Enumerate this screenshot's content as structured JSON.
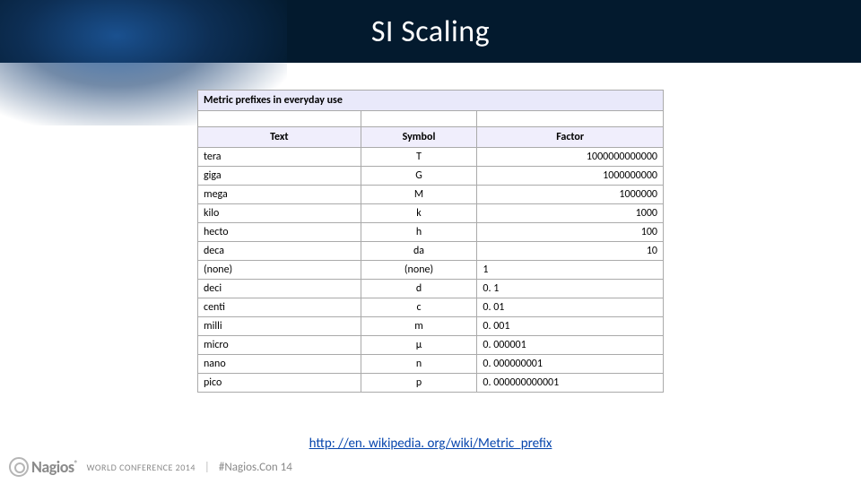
{
  "slide": {
    "title": "SI Scaling",
    "table_caption": "Metric prefixes in everyday use",
    "headers": {
      "text": "Text",
      "symbol": "Symbol",
      "factor": "Factor"
    },
    "rows": [
      {
        "text": "tera",
        "symbol": "T",
        "factor": "1000000000000",
        "align": "right"
      },
      {
        "text": "giga",
        "symbol": "G",
        "factor": "1000000000",
        "align": "right"
      },
      {
        "text": "mega",
        "symbol": "M",
        "factor": "1000000",
        "align": "right"
      },
      {
        "text": "kilo",
        "symbol": "k",
        "factor": "1000",
        "align": "right"
      },
      {
        "text": "hecto",
        "symbol": "h",
        "factor": "100",
        "align": "right"
      },
      {
        "text": "deca",
        "symbol": "da",
        "factor": "10",
        "align": "right"
      },
      {
        "text": "(none)",
        "symbol": "(none)",
        "factor": "1",
        "align": "left"
      },
      {
        "text": "deci",
        "symbol": "d",
        "factor": "0. 1",
        "align": "left"
      },
      {
        "text": "centi",
        "symbol": "c",
        "factor": "0. 01",
        "align": "left"
      },
      {
        "text": "milli",
        "symbol": "m",
        "factor": "0. 001",
        "align": "left"
      },
      {
        "text": "micro",
        "symbol": "μ",
        "factor": "0. 000001",
        "align": "left"
      },
      {
        "text": "nano",
        "symbol": "n",
        "factor": "0. 000000001",
        "align": "left"
      },
      {
        "text": "pico",
        "symbol": "p",
        "factor": "0. 000000000001",
        "align": "left"
      }
    ],
    "source_link": "http: //en. wikipedia. org/wiki/Metric_prefix"
  },
  "footer": {
    "brand": "Nagios",
    "reg": "®",
    "conf": "WORLD CONFERENCE 2014",
    "hashtag": "#Nagios.Con 14"
  }
}
